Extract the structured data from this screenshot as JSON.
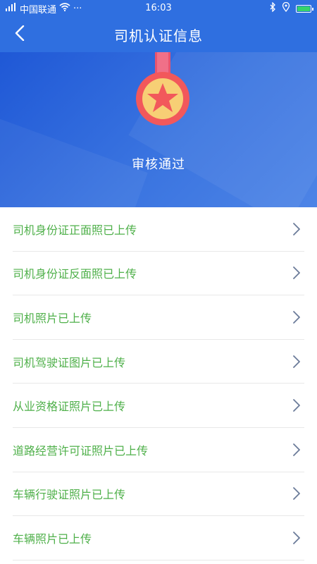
{
  "status_bar": {
    "carrier": "中国联通",
    "extra": "···",
    "time": "16:03"
  },
  "nav": {
    "title": "司机认证信息"
  },
  "hero": {
    "status_text": "审核通过"
  },
  "list": {
    "items": [
      {
        "label": "司机身份证正面照已上传"
      },
      {
        "label": "司机身份证反面照已上传"
      },
      {
        "label": "司机照片已上传"
      },
      {
        "label": "司机驾驶证图片已上传"
      },
      {
        "label": "从业资格证照片已上传"
      },
      {
        "label": "道路经营许可证照片已上传"
      },
      {
        "label": "车辆行驶证照片已上传"
      },
      {
        "label": "车辆照片已上传"
      }
    ]
  },
  "colors": {
    "primary": "#2f6fe0",
    "item_text": "#4fb04a",
    "medal_outer": "#f2585b",
    "medal_inner": "#f7cf75",
    "ribbon": "#e8546f"
  }
}
